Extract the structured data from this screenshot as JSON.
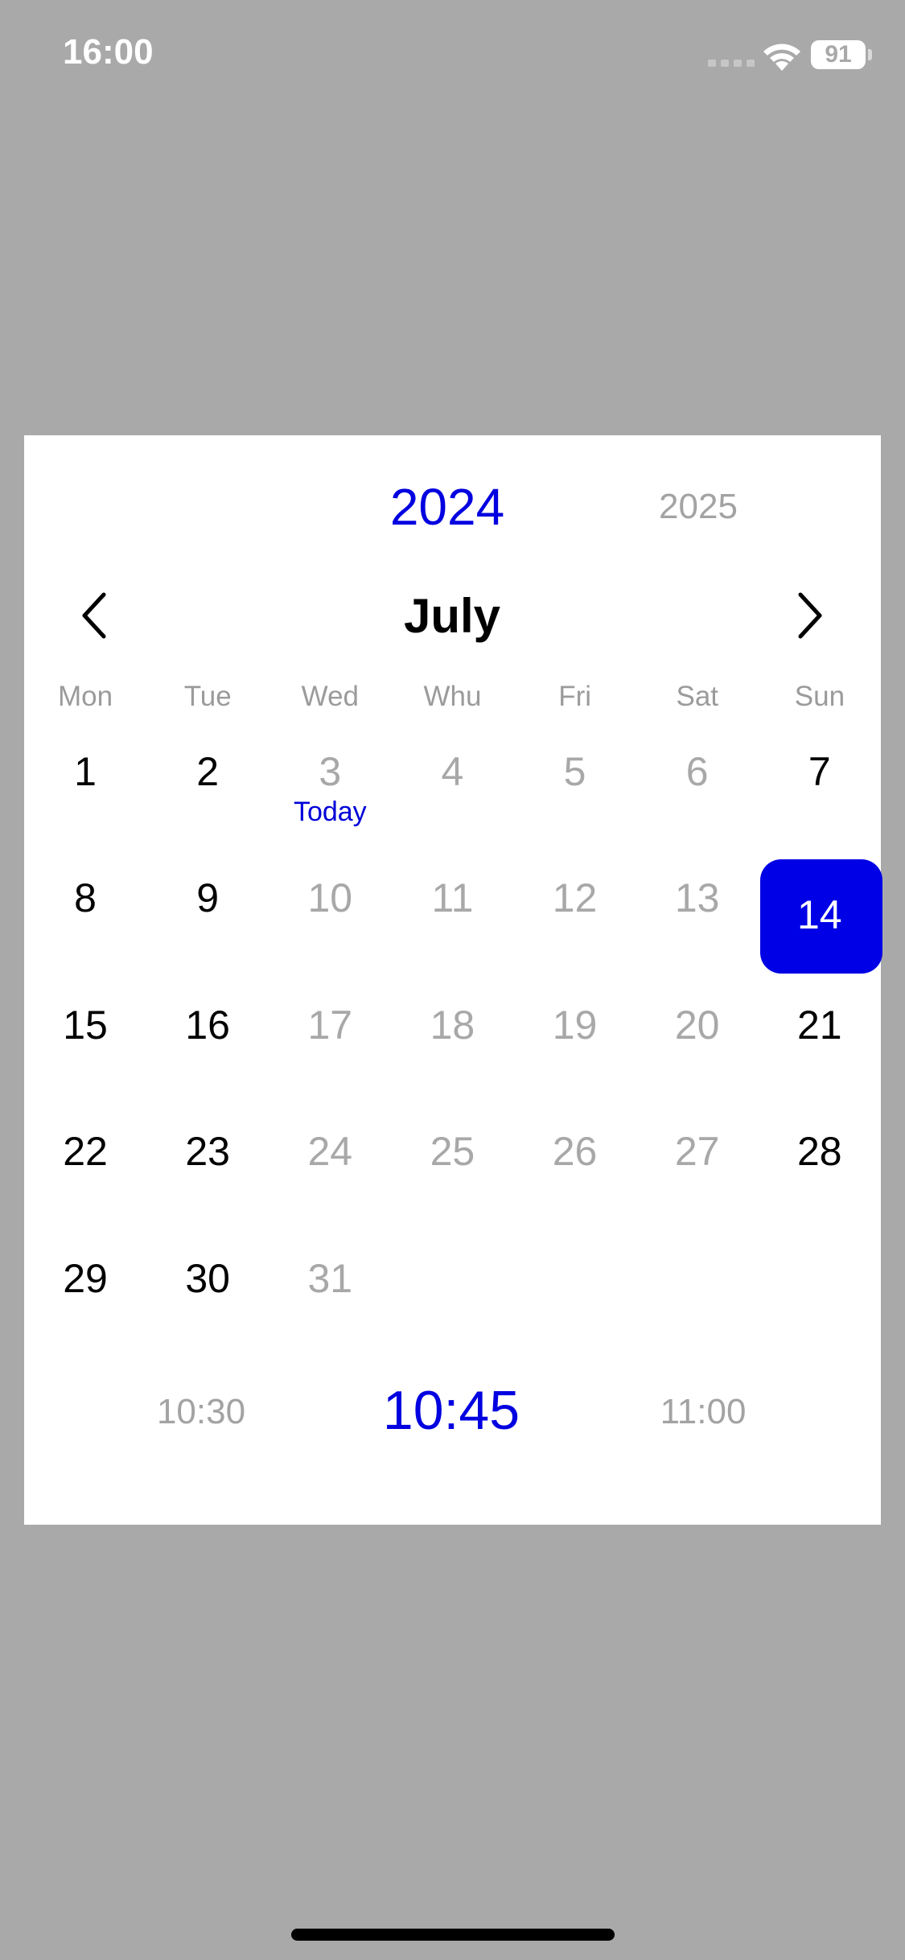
{
  "status_bar": {
    "time": "16:00",
    "battery": "91"
  },
  "picker": {
    "years": [
      {
        "label": "2024",
        "selected": true
      },
      {
        "label": "2025",
        "selected": false
      }
    ],
    "month": "July",
    "weekdays": [
      "Mon",
      "Tue",
      "Wed",
      "Whu",
      "Fri",
      "Sat",
      "Sun"
    ],
    "days": [
      {
        "label": "1",
        "muted": false
      },
      {
        "label": "2",
        "muted": false
      },
      {
        "label": "3",
        "muted": true,
        "today": true
      },
      {
        "label": "4",
        "muted": true
      },
      {
        "label": "5",
        "muted": true
      },
      {
        "label": "6",
        "muted": true
      },
      {
        "label": "7",
        "muted": false
      },
      {
        "label": "8",
        "muted": false
      },
      {
        "label": "9",
        "muted": false
      },
      {
        "label": "10",
        "muted": true
      },
      {
        "label": "11",
        "muted": true
      },
      {
        "label": "12",
        "muted": true
      },
      {
        "label": "13",
        "muted": true
      },
      {
        "label": "14",
        "muted": false,
        "selected": true
      },
      {
        "label": "15",
        "muted": false
      },
      {
        "label": "16",
        "muted": false
      },
      {
        "label": "17",
        "muted": true
      },
      {
        "label": "18",
        "muted": true
      },
      {
        "label": "19",
        "muted": true
      },
      {
        "label": "20",
        "muted": true
      },
      {
        "label": "21",
        "muted": false
      },
      {
        "label": "22",
        "muted": false
      },
      {
        "label": "23",
        "muted": false
      },
      {
        "label": "24",
        "muted": true
      },
      {
        "label": "25",
        "muted": true
      },
      {
        "label": "26",
        "muted": true
      },
      {
        "label": "27",
        "muted": true
      },
      {
        "label": "28",
        "muted": false
      },
      {
        "label": "29",
        "muted": false
      },
      {
        "label": "30",
        "muted": false
      },
      {
        "label": "31",
        "muted": true
      }
    ],
    "today_label": "Today",
    "times": [
      {
        "label": "10:30",
        "selected": false
      },
      {
        "label": "10:45",
        "selected": true
      },
      {
        "label": "11:00",
        "selected": false
      }
    ]
  },
  "icons": {
    "prev": "chevron-left-icon",
    "next": "chevron-right-icon",
    "wifi": "wifi-icon",
    "signal": "cellular-signal-icon",
    "battery": "battery-icon"
  },
  "colors": {
    "accent": "#0000e6",
    "muted_text": "#a8a8a8",
    "backdrop": "#a9a9a9"
  }
}
